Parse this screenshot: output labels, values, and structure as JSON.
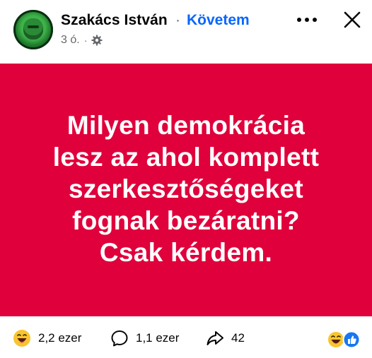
{
  "post": {
    "author": "Szakács István",
    "separator": "·",
    "follow_label": "Követem",
    "time": "3 ó.",
    "meta_separator": "·",
    "privacy_icon": "gear-icon",
    "banner_color": "#e0003b",
    "text_lines": [
      "Milyen demokrácia",
      "lesz az ahol komplett",
      "szerkesztőségeket",
      "fognak bezáratni?",
      "Csak kérdem."
    ]
  },
  "stats": {
    "reactions": "2,2 ezer",
    "comments": "1,1 ezer",
    "shares": "42"
  },
  "colors": {
    "accent": "#0866ff",
    "secondary_text": "#65676b"
  }
}
